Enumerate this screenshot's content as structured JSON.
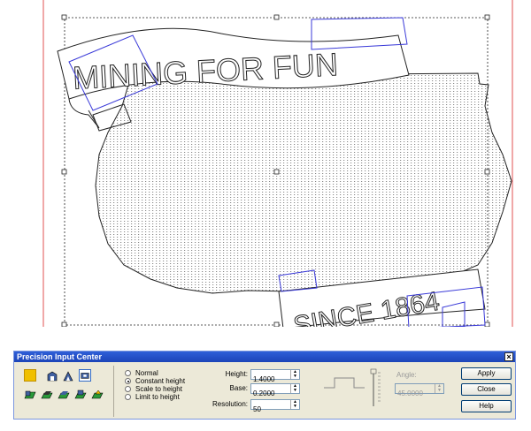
{
  "canvas": {
    "banner_top_text": "MINING FOR FUN",
    "banner_bottom_text": "SINCE 1864"
  },
  "dialog": {
    "title": "Precision Input Center",
    "close_glyph": "×",
    "radios": [
      {
        "label": "Normal",
        "selected": false
      },
      {
        "label": "Constant height",
        "selected": true
      },
      {
        "label": "Scale to height",
        "selected": false
      },
      {
        "label": "Limit to height",
        "selected": false
      }
    ],
    "height_label": "Height:",
    "height_value": "1.4000",
    "base_label": "Base:",
    "base_value": "0.2000",
    "resolution_label": "Resolution:",
    "resolution_value": "50",
    "angle_label": "Angle:",
    "angle_value": "45.0000",
    "apply_label": "Apply",
    "close_label": "Close",
    "help_label": "Help"
  },
  "colors": {
    "titlebar": "#1c44b8",
    "selection_blue": "#3a3ad8",
    "page_border_red": "#e05050"
  }
}
